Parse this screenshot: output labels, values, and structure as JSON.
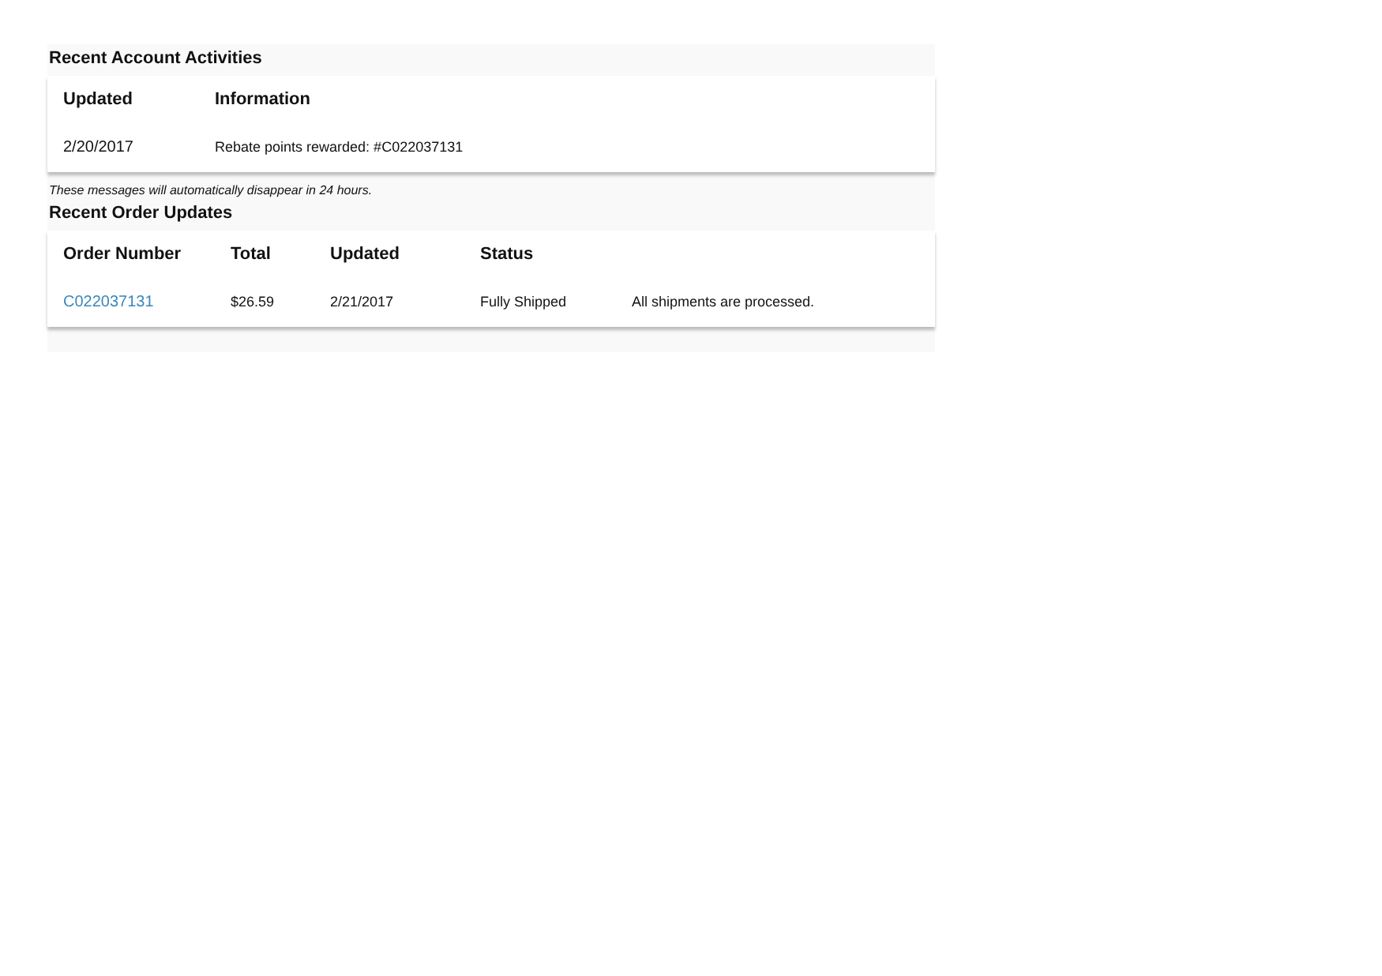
{
  "activities": {
    "title": "Recent Account Activities",
    "columns": [
      "Updated",
      "Information"
    ],
    "rows": [
      {
        "updated": "2/20/2017",
        "information": "Rebate points rewarded: #C022037131"
      }
    ]
  },
  "note": "These messages will automatically disappear in 24 hours.",
  "orders": {
    "title": "Recent Order Updates",
    "columns": [
      "Order Number",
      "Total",
      "Updated",
      "Status"
    ],
    "rows": [
      {
        "order_number": "C022037131",
        "total": "$26.59",
        "updated": "2/21/2017",
        "status": "Fully Shipped",
        "column_5": "All shipments are processed."
      }
    ]
  }
}
